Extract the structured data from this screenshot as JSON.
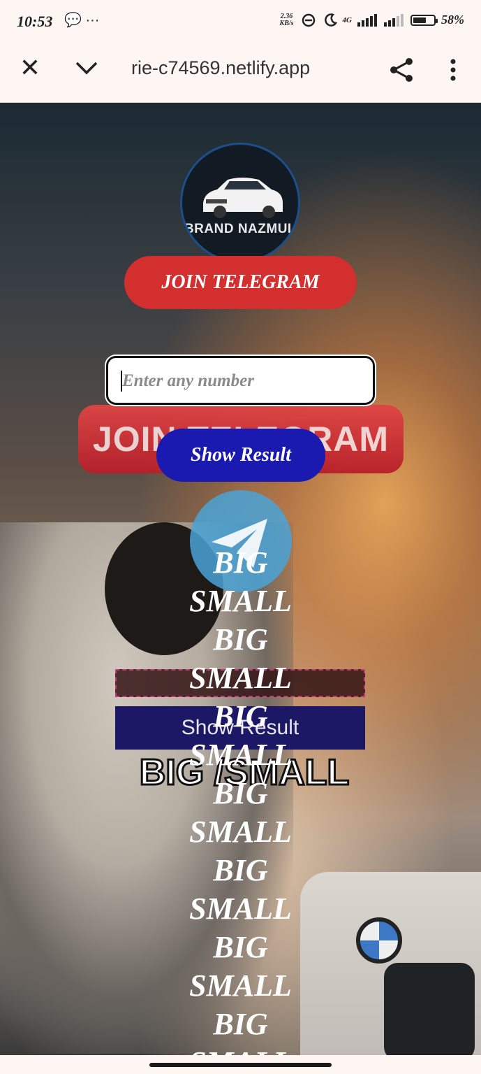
{
  "status_bar": {
    "time": "10:53",
    "left_icons": "💬 ···",
    "speed_value": "2.36",
    "speed_unit": "KB/s",
    "network": "4G",
    "battery": "58%"
  },
  "browser": {
    "url": "rie-c74569.netlify.app"
  },
  "page": {
    "logo_text": "BRAND NAZMUL",
    "join_button": "JOIN TELEGRAM",
    "input_placeholder": "Enter any number",
    "bg_join_text": "JOIN TELEGRAM",
    "show_result_button": "Show Result",
    "bg_show_text": "Show Result",
    "bg_bigsmall_text": "BIG /SMALL",
    "results": [
      "BIG",
      "SMALL",
      "BIG",
      "SMALL",
      "BIG",
      "SMALL",
      "BIG",
      "SMALL",
      "BIG",
      "SMALL",
      "BIG",
      "SMALL",
      "BIG",
      "SMALL"
    ]
  },
  "colors": {
    "join_button": "#d32f2f",
    "show_result_button": "#1b1ab0"
  }
}
